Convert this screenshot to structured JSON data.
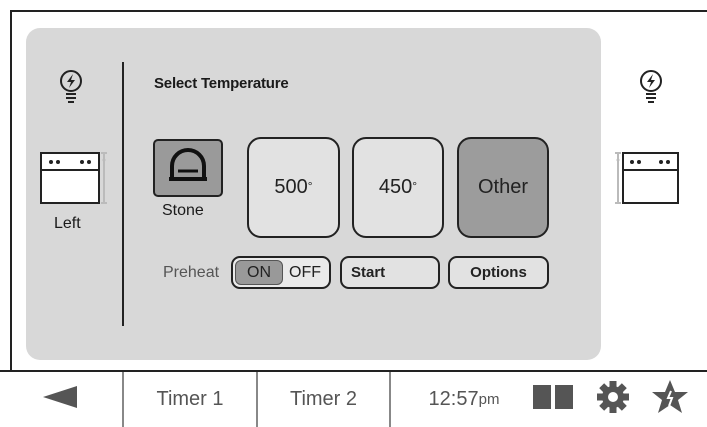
{
  "panel": {
    "title": "Select Temperature"
  },
  "ovens": {
    "left_label": "Left"
  },
  "stone": {
    "label": "Stone"
  },
  "temperatures": [
    {
      "value": "500",
      "degree": "°",
      "selected": false
    },
    {
      "value": "450",
      "degree": "°",
      "selected": false
    },
    {
      "value": "Other",
      "selected": true
    }
  ],
  "preheat": {
    "label": "Preheat",
    "on_label": "ON",
    "off_label": "OFF",
    "state": "ON"
  },
  "actions": {
    "start_label": "Start",
    "options_label": "Options"
  },
  "bottom_bar": {
    "timer1_label": "Timer 1",
    "timer2_label": "Timer 2",
    "time": "12:57",
    "ampm": "pm"
  },
  "icons": {
    "back": "back-arrow-icon",
    "light": "lightbulb-icon",
    "oven": "oven-icon",
    "stone": "stone-icon",
    "layout": "split-view-icon",
    "settings": "gear-icon",
    "favorites": "star-icon"
  },
  "colors": {
    "panel_bg": "#d8d8d8",
    "selected_bg": "#9c9c9c",
    "button_bg": "#e2e2e2",
    "icon_gray": "#666666"
  }
}
